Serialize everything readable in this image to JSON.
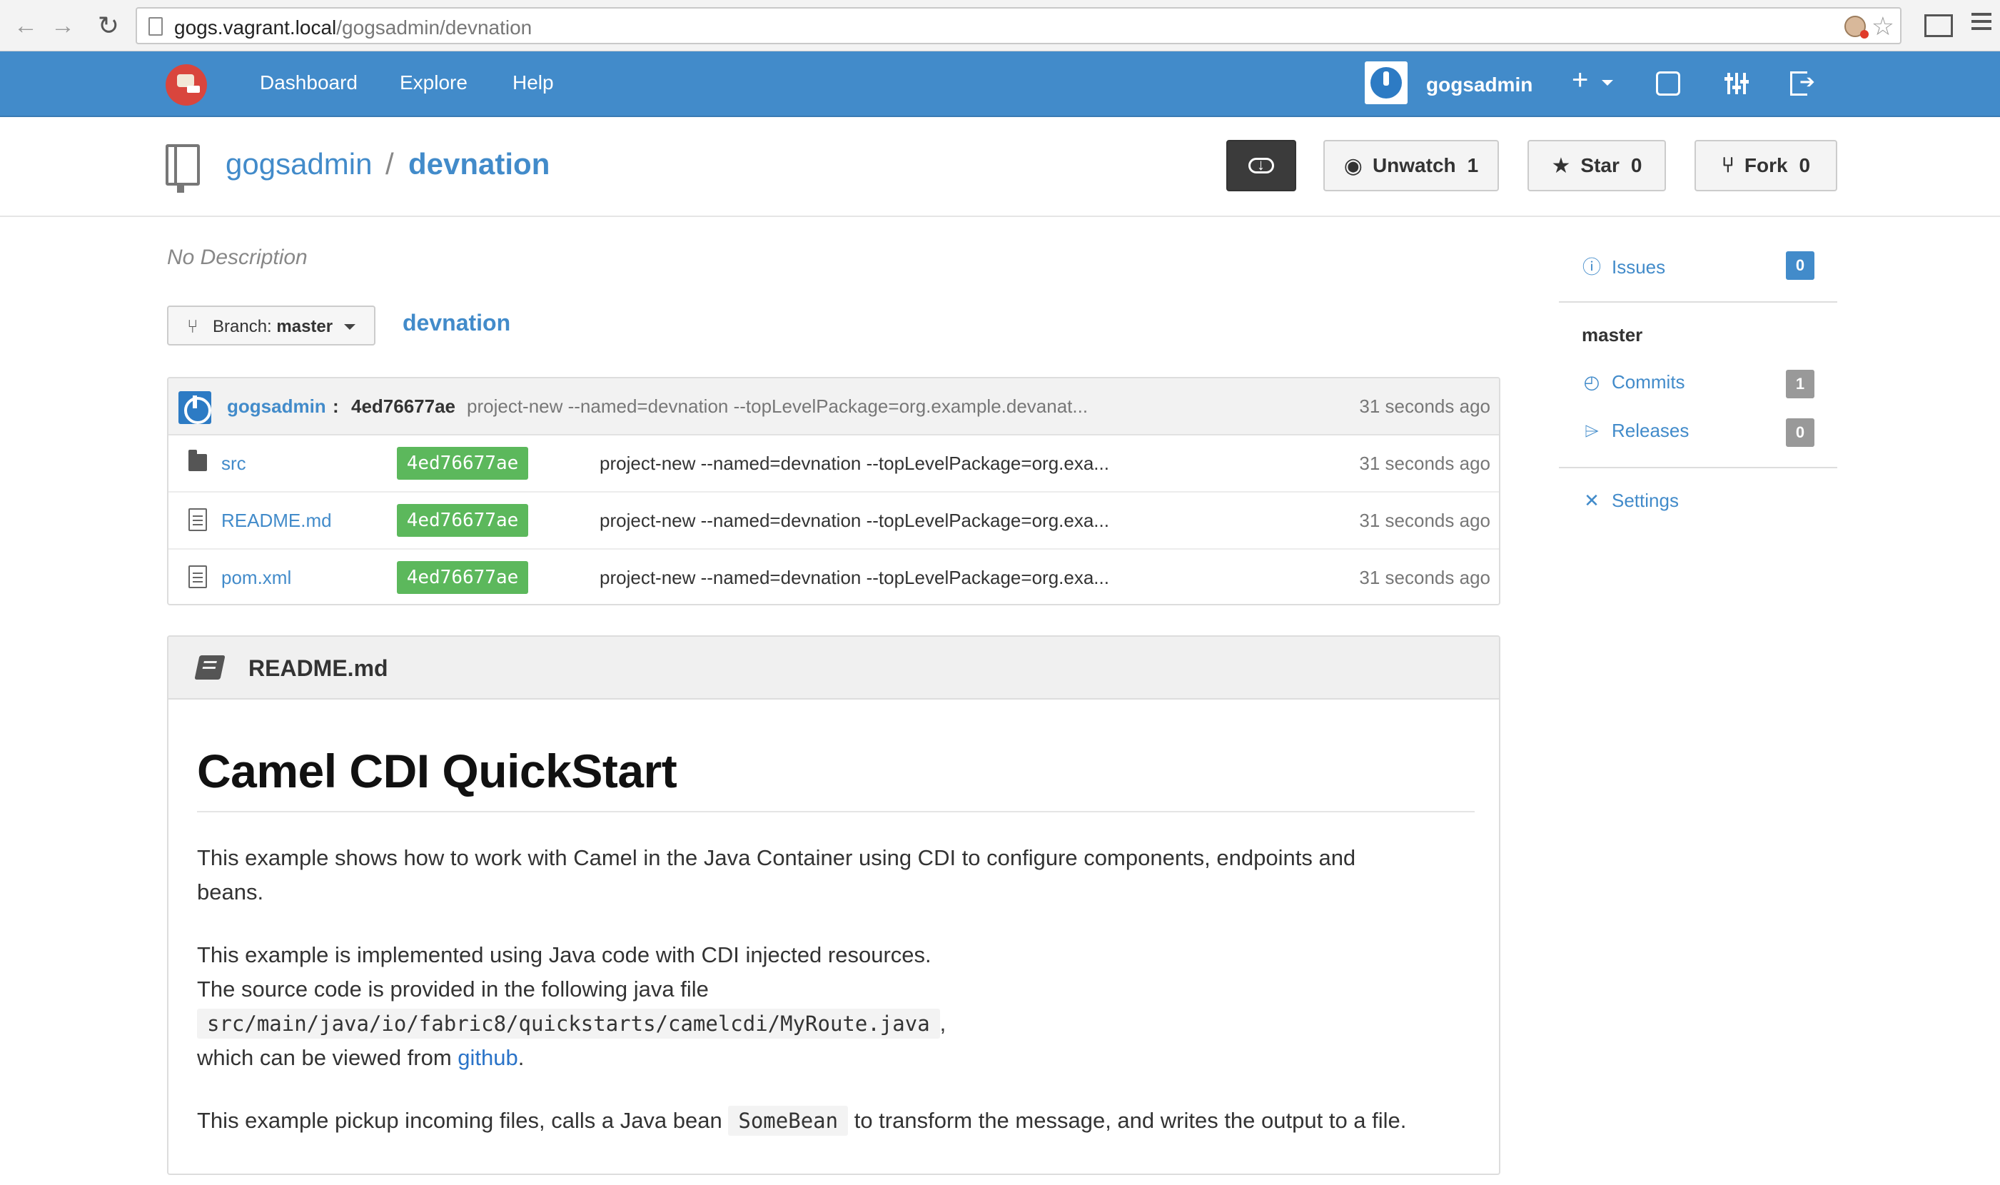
{
  "browser": {
    "url_host": "gogs.vagrant.local",
    "url_path": "/gogsadmin/devnation"
  },
  "header": {
    "nav": {
      "dashboard": "Dashboard",
      "explore": "Explore",
      "help": "Help"
    },
    "username": "gogsadmin",
    "plus_label": "+"
  },
  "repo": {
    "owner": "gogsadmin",
    "separator": "/",
    "name": "devnation",
    "unwatch_label": "Unwatch",
    "unwatch_count": "1",
    "star_label": "Star",
    "star_count": "0",
    "fork_label": "Fork",
    "fork_count": "0",
    "description": "No Description"
  },
  "branch": {
    "label": "Branch:",
    "value": "master",
    "breadcrumb": "devnation"
  },
  "latest_commit": {
    "author": "gogsadmin",
    "separator": ":",
    "sha": "4ed76677ae",
    "message": "project-new --named=devnation --topLevelPackage=org.example.devanat...",
    "time": "31 seconds ago"
  },
  "files": [
    {
      "name": "src",
      "sha": "4ed76677ae",
      "message": "project-new --named=devnation --topLevelPackage=org.exa...",
      "time": "31 seconds ago"
    },
    {
      "name": "README.md",
      "sha": "4ed76677ae",
      "message": "project-new --named=devnation --topLevelPackage=org.exa...",
      "time": "31 seconds ago"
    },
    {
      "name": "pom.xml",
      "sha": "4ed76677ae",
      "message": "project-new --named=devnation --topLevelPackage=org.exa...",
      "time": "31 seconds ago"
    }
  ],
  "readme": {
    "filename": "README.md",
    "h1": "Camel CDI QuickStart",
    "p1": "This example shows how to work with Camel in the Java Container using CDI to configure components, endpoints and beans.",
    "p2_line1": "This example is implemented using Java code with CDI injected resources.",
    "p2_line2": "The source code is provided in the following java file",
    "p2_code": "src/main/java/io/fabric8/quickstarts/camelcdi/MyRoute.java",
    "p2_after_code": ",",
    "p2_line3_pre": "which can be viewed from",
    "p2_link": "github",
    "p2_line3_post": ".",
    "p3_pre": "This example pickup incoming files, calls a Java bean",
    "p3_code": "SomeBean",
    "p3_post": "to transform the message, and writes the output to a file."
  },
  "sidebar": {
    "issues_label": "Issues",
    "issues_count": "0",
    "branch_heading": "master",
    "commits_label": "Commits",
    "commits_count": "1",
    "releases_label": "Releases",
    "releases_count": "0",
    "settings_label": "Settings"
  },
  "colors": {
    "header_blue": "#428bca",
    "sha_green": "#5cb85c",
    "link_blue": "#428bca"
  }
}
